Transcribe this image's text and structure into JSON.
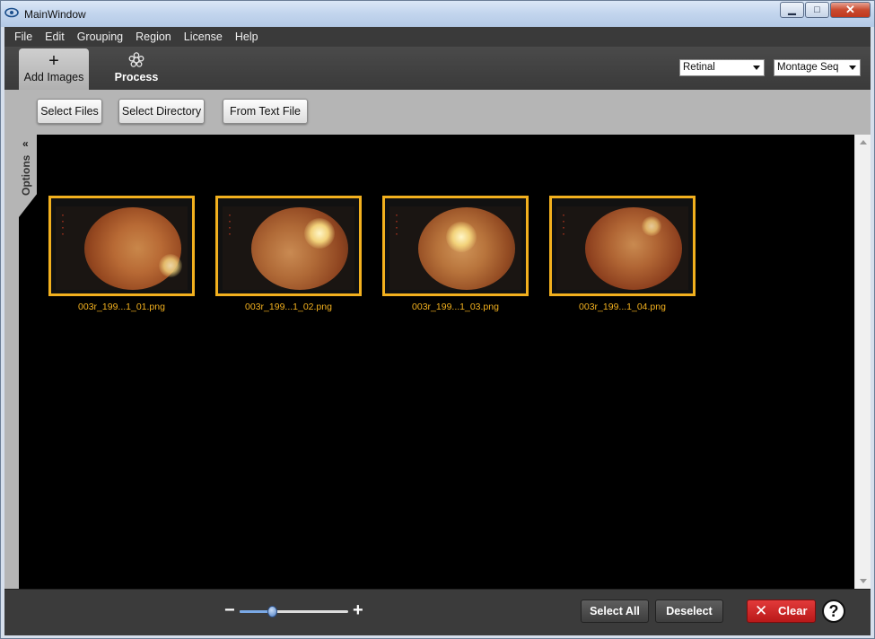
{
  "window": {
    "title": "MainWindow"
  },
  "menu": [
    "File",
    "Edit",
    "Grouping",
    "Region",
    "License",
    "Help"
  ],
  "toolbar": {
    "tabs": [
      {
        "label": "Add Images",
        "icon": "plus-icon",
        "active": true
      },
      {
        "label": "Process",
        "icon": "flower-gear-icon",
        "active": false
      }
    ],
    "modality": "Retinal",
    "sequence": "Montage Seq"
  },
  "add_images": {
    "select_files": "Select Files",
    "select_directory": "Select Directory",
    "from_text_file": "From Text File"
  },
  "options_tab": {
    "label": "Options",
    "chevron": "«"
  },
  "images": [
    {
      "name": "003r_199...1_01.png"
    },
    {
      "name": "003r_199...1_02.png"
    },
    {
      "name": "003r_199...1_03.png"
    },
    {
      "name": "003r_199...1_04.png"
    }
  ],
  "zoom": {
    "minus": "−",
    "plus": "+",
    "level": 0.3
  },
  "footer": {
    "select_all": "Select All",
    "deselect": "Deselect",
    "clear": "Clear",
    "help": "?"
  },
  "colors": {
    "accent": "#f2b01e",
    "clear": "#d22a2a",
    "canvas": "#000000"
  }
}
